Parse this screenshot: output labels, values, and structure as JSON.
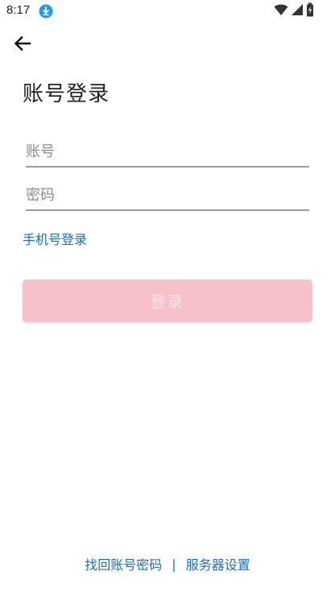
{
  "status_bar": {
    "time": "8:17",
    "icons": [
      "download-icon",
      "wifi-icon",
      "signal-icon",
      "battery-icon"
    ]
  },
  "header": {
    "back_icon": "arrow-left-icon"
  },
  "page": {
    "title": "账号登录"
  },
  "form": {
    "account_placeholder": "账号",
    "account_value": "",
    "password_placeholder": "密码",
    "password_value": ""
  },
  "links": {
    "phone_login": "手机号登录"
  },
  "login_button": {
    "label": "登录",
    "enabled": false
  },
  "footer": {
    "recover_account": "找回账号密码",
    "separator": "|",
    "server_settings": "服务器设置"
  },
  "colors": {
    "link": "#1a6fb5",
    "login_button_bg": "#f7c1ca",
    "login_button_text": "#f6e6e9",
    "download_icon": "#1e9be9"
  }
}
